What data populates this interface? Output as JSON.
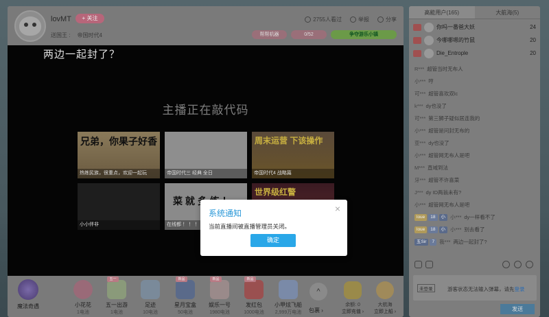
{
  "header": {
    "streamer_name": "lovMT",
    "follow_label": "+ 关注",
    "send_king_label": "送国王 :",
    "send_king_value": "帝国时代4",
    "viewers": "2755人看过",
    "report": "举报",
    "share": "分享",
    "pill_1": "帮帮机器",
    "pill_2": "0/52",
    "pill_3": "争夺游乐小镇"
  },
  "video": {
    "title_overlay": "两边一起封了？",
    "center_message": "主播正在敲代码",
    "recommendations": [
      {
        "big_text": "兄弟，你果子好香",
        "caption": "热练民族，很重点，欢迎一起玩"
      },
      {
        "big_text": "",
        "caption": "帝国时代三 经典 全日"
      },
      {
        "big_text": "周末运营 下该操作",
        "caption": "帝国时代4 战略篇"
      },
      {
        "big_text": "",
        "caption": "小小伴非"
      },
      {
        "big_text": "菜 就 多 练 ！",
        "caption": "在线都 ！ ！ ！"
      },
      {
        "big_text": "世界级红警",
        "caption": ""
      }
    ]
  },
  "gift_bar": {
    "magic_label": "魔法奇遇",
    "gifts": [
      {
        "name": "小花花",
        "price": "1电池",
        "tag": ""
      },
      {
        "name": "五一出游",
        "price": "1电池",
        "tag": "五一"
      },
      {
        "name": "足迹",
        "price": "10电池",
        "tag": ""
      },
      {
        "name": "星月宝盒",
        "price": "50电池",
        "tag": "新品"
      },
      {
        "name": "娱乐一号",
        "price": "1980电池",
        "tag": "新品"
      },
      {
        "name": "发红包",
        "price": "1000电池",
        "tag": "新品"
      },
      {
        "name": "小甲炫飞船",
        "price": "2,999万电池",
        "tag": ""
      }
    ],
    "more_label": "包裹 ›",
    "balance_label": "余额: 0",
    "recharge_label": "立即充值 ›",
    "voyage_label": "大航海",
    "voyage_action": "立即上船 ›"
  },
  "side": {
    "tab_high_energy": "高能用户(165)",
    "tab_voyage": "大航海(5)",
    "rank": [
      {
        "name": "你吗一番爸大妖",
        "value": "24"
      },
      {
        "name": "今哪哪嗯的竹鼠",
        "value": "20"
      },
      {
        "name": "Die_Entrople",
        "value": "20"
      }
    ],
    "chat": [
      {
        "user": "R***",
        "text": "超管当时无布人"
      },
      {
        "user": "小***",
        "text": "哼"
      },
      {
        "user": "可***",
        "text": "超管喜欢双lc"
      },
      {
        "user": "k***",
        "text": "dy也没了"
      },
      {
        "user": "可***",
        "text": "第三狮子疑似居连我的"
      },
      {
        "user": "小***",
        "text": "超管是问封无布的"
      },
      {
        "user": "亚***",
        "text": "dy也没了"
      },
      {
        "user": "小***",
        "text": "超管网无布人是吧"
      },
      {
        "user": "M***",
        "text": "直域到法"
      },
      {
        "user": "牙***",
        "text": "超管不许喜菜"
      },
      {
        "user": "J***",
        "text": "dy ID两翁未有?"
      },
      {
        "user": "小***",
        "text": "超管网无布人是吧"
      },
      {
        "user": "小***",
        "text": "dy一样看不了",
        "badges": [
          "loue",
          "18",
          "小"
        ]
      },
      {
        "user": "小***",
        "text": "别去看了",
        "badges": [
          "loue",
          "18",
          "小"
        ]
      },
      {
        "user": "我***",
        "text": "两边一起封了?",
        "badges": [
          "五Sir",
          "7"
        ]
      }
    ],
    "input_level_tag": "未登录",
    "input_placeholder": "游客状态无法输入弹幕，请先",
    "input_login_link": "登录",
    "send_label": "发送"
  },
  "modal": {
    "title": "系统通知",
    "message": "当前直播间被直播管理员关闭。",
    "ok_label": "确定",
    "close_glyph": "×"
  }
}
